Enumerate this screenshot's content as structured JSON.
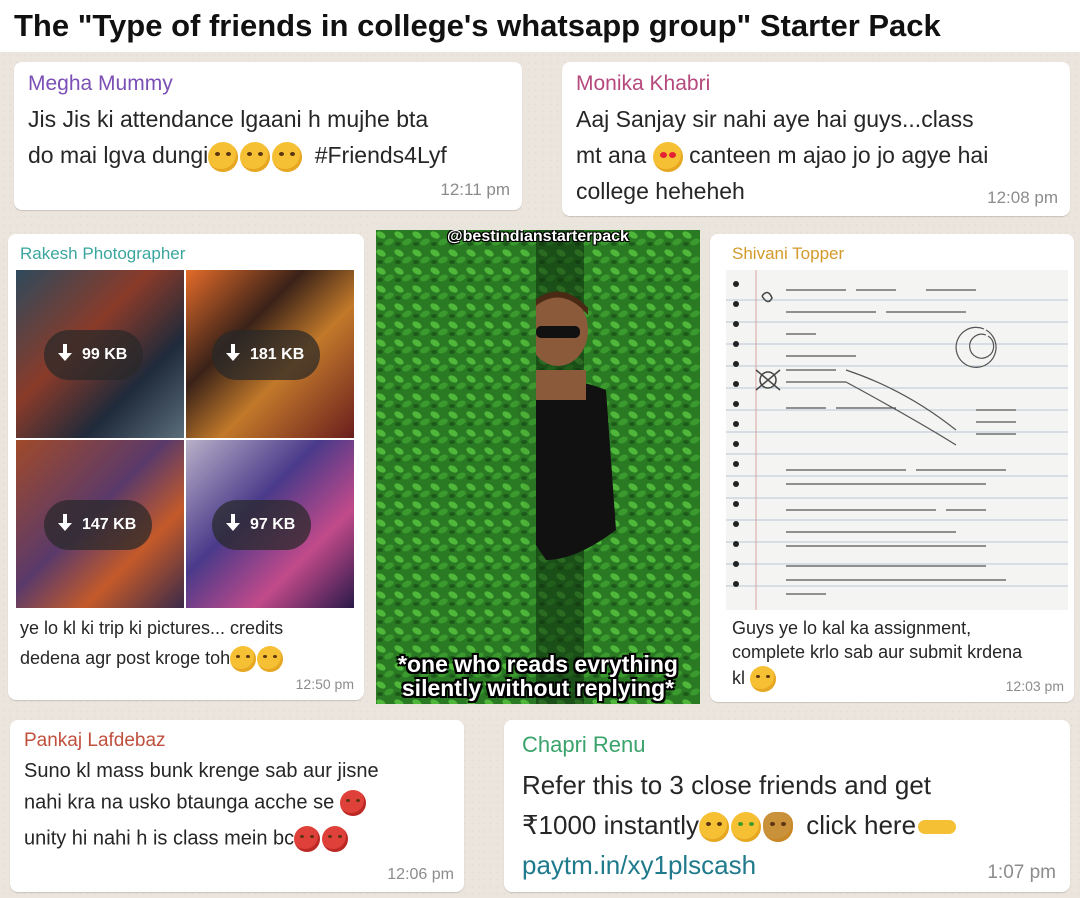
{
  "title": "The \"Type of friends in college's whatsapp group\" Starter Pack",
  "colors": {
    "page_background": "#e9e4dc",
    "bubble": "#ffffff",
    "time": "#8c8c8c",
    "megha": "#7b4fb5",
    "monika": "#b5497d",
    "rakesh": "#3aa69e",
    "shivani": "#d49a2a",
    "pankaj": "#c0503d",
    "renu": "#3aa36b",
    "link": "#1f7a8c"
  },
  "messages": {
    "megha": {
      "sender": "Megha Mummy",
      "line1": "Jis Jis ki attendance lgaani h mujhe bta",
      "line2_text": "do mai lgva dungi",
      "line2_suffix": "#Friends4Lyf",
      "emojis": [
        "kissing-face-icon",
        "kissing-face-icon",
        "kissing-face-icon"
      ],
      "time": "12:11 pm"
    },
    "monika": {
      "sender": "Monika Khabri",
      "line1": "Aaj Sanjay sir nahi aye hai guys...class",
      "line2_a": "mt ana",
      "line2_b": "canteen m ajao jo jo agye hai",
      "line3": "college heheheh",
      "emojis": [
        "heart-eyes-face-icon"
      ],
      "time": "12:08 pm"
    },
    "rakesh": {
      "sender": "Rakesh Photographer",
      "downloads": [
        "99 KB",
        "181 KB",
        "147 KB",
        "97 KB"
      ],
      "line1": "ye lo kl ki trip ki pictures... credits",
      "line2": "dedena agr post kroge toh",
      "emojis": [
        "sad-face-icon",
        "laughing-face-icon"
      ],
      "time": "12:50 pm"
    },
    "meme": {
      "handle": "@bestindianstarterpack",
      "caption_line1": "*one who reads evrything",
      "caption_line2": "silently without replying*"
    },
    "shivani": {
      "sender": "Shivani Topper",
      "line1": "Guys ye lo kal ka assignment,",
      "line2": "complete krlo sab aur submit krdena",
      "line3": "kl",
      "emojis": [
        "grinning-face-icon"
      ],
      "time": "12:03 pm"
    },
    "pankaj": {
      "sender": "Pankaj Lafdebaz",
      "line1": "Suno kl mass bunk krenge sab aur jisne",
      "line2": "nahi kra na usko btaunga acche se",
      "line3": "unity hi nahi h is class mein bc",
      "emojis": [
        "angry-face-icon",
        "angry-face-icon",
        "angry-face-icon"
      ],
      "time": "12:06 pm"
    },
    "renu": {
      "sender": "Chapri Renu",
      "line1": "Refer this to 3 close friends and get",
      "line2_a": "₹1000 instantly",
      "line2_b": "click here",
      "link": "paytm.in/xy1plscash",
      "emojis": [
        "star-struck-face-icon",
        "money-mouth-face-icon",
        "money-bag-icon",
        "pointing-hand-icon"
      ],
      "time": "1:07 pm"
    }
  }
}
